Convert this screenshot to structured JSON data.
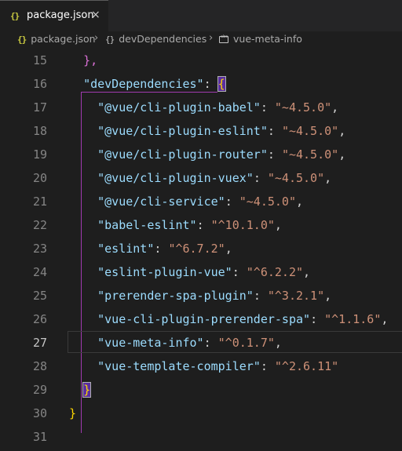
{
  "tab": {
    "icon": "{}",
    "label": "package.json",
    "close": "×"
  },
  "breadcrumb": {
    "items": [
      {
        "icon": "{}",
        "label": "package.json"
      },
      {
        "icon": "{}",
        "label": "devDependencies"
      },
      {
        "icon": "string-icon",
        "label": "vue-meta-info"
      }
    ],
    "separator": "›"
  },
  "editor": {
    "active_line": "27",
    "lines": [
      {
        "num": "15",
        "indent": "  ",
        "key": "",
        "value": "",
        "tail": "},",
        "tail_color": "b2"
      },
      {
        "num": "16",
        "indent": "  ",
        "key": "\"devDependencies\"",
        "value": "",
        "tail": "{",
        "tail_color": "b1"
      },
      {
        "num": "17",
        "indent": "    ",
        "key": "\"@vue/cli-plugin-babel\"",
        "value": "\"~4.5.0\"",
        "tail": ","
      },
      {
        "num": "18",
        "indent": "    ",
        "key": "\"@vue/cli-plugin-eslint\"",
        "value": "\"~4.5.0\"",
        "tail": ","
      },
      {
        "num": "19",
        "indent": "    ",
        "key": "\"@vue/cli-plugin-router\"",
        "value": "\"~4.5.0\"",
        "tail": ","
      },
      {
        "num": "20",
        "indent": "    ",
        "key": "\"@vue/cli-plugin-vuex\"",
        "value": "\"~4.5.0\"",
        "tail": ","
      },
      {
        "num": "21",
        "indent": "    ",
        "key": "\"@vue/cli-service\"",
        "value": "\"~4.5.0\"",
        "tail": ","
      },
      {
        "num": "22",
        "indent": "    ",
        "key": "\"babel-eslint\"",
        "value": "\"^10.1.0\"",
        "tail": ","
      },
      {
        "num": "23",
        "indent": "    ",
        "key": "\"eslint\"",
        "value": "\"^6.7.2\"",
        "tail": ","
      },
      {
        "num": "24",
        "indent": "    ",
        "key": "\"eslint-plugin-vue\"",
        "value": "\"^6.2.2\"",
        "tail": ","
      },
      {
        "num": "25",
        "indent": "    ",
        "key": "\"prerender-spa-plugin\"",
        "value": "\"^3.2.1\"",
        "tail": ","
      },
      {
        "num": "26",
        "indent": "    ",
        "key": "\"vue-cli-plugin-prerender-spa\"",
        "value": "\"^1.1.6\"",
        "tail": ","
      },
      {
        "num": "27",
        "indent": "    ",
        "key": "\"vue-meta-info\"",
        "value": "\"^0.1.7\"",
        "tail": ","
      },
      {
        "num": "28",
        "indent": "    ",
        "key": "\"vue-template-compiler\"",
        "value": "\"^2.6.11\"",
        "tail": ""
      },
      {
        "num": "29",
        "indent": "  ",
        "key": "",
        "value": "",
        "tail": "}",
        "tail_color": "b1"
      },
      {
        "num": "30",
        "indent": "",
        "key": "",
        "value": "",
        "tail": "}",
        "tail_color": "b1"
      },
      {
        "num": "31",
        "indent": "",
        "key": "",
        "value": "",
        "tail": ""
      }
    ]
  },
  "colors": {
    "background": "#1e1e1e",
    "key": "#9cdcfe",
    "string": "#ce9178",
    "bracket_gold": "#ffd700",
    "bracket_purple": "#da70d6"
  }
}
